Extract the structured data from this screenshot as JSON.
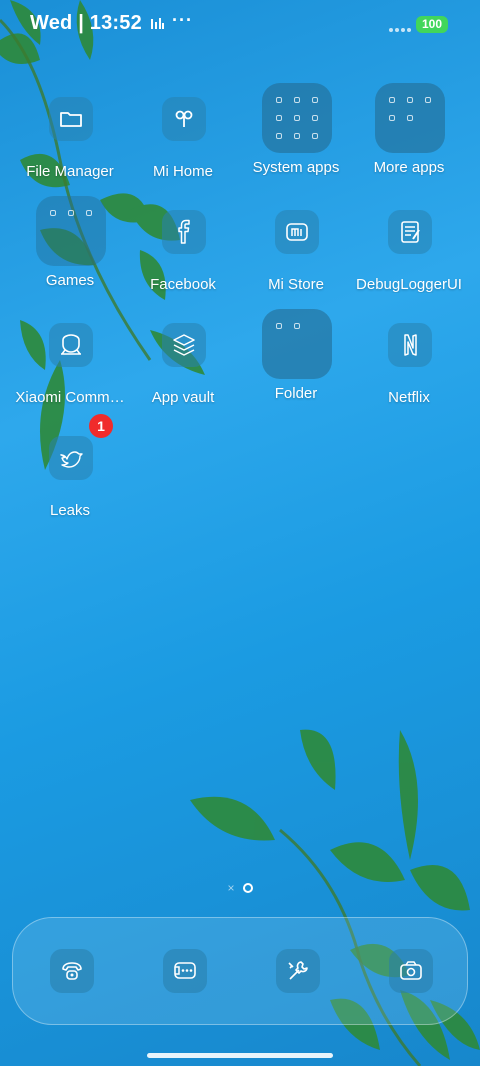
{
  "status_bar": {
    "time": "Wed | 13:52",
    "dots": "···",
    "battery": "100"
  },
  "apps": [
    {
      "label": "File Manager",
      "icon": "folder-icon"
    },
    {
      "label": "Mi Home",
      "icon": "mi-home-icon"
    },
    {
      "label": "System apps",
      "icon": "folder-grid"
    },
    {
      "label": "More apps",
      "icon": "folder-grid"
    },
    {
      "label": "Games",
      "icon": "folder-grid"
    },
    {
      "label": "Facebook",
      "icon": "facebook-icon"
    },
    {
      "label": "Mi Store",
      "icon": "mi-store-icon"
    },
    {
      "label": "DebugLoggerUI",
      "icon": "debug-logger-icon"
    },
    {
      "label": "Xiaomi Comm…",
      "icon": "xiaomi-community-icon"
    },
    {
      "label": "App vault",
      "icon": "app-vault-icon"
    },
    {
      "label": "Folder",
      "icon": "folder-grid"
    },
    {
      "label": "Netflix",
      "icon": "netflix-icon"
    },
    {
      "label": "Leaks",
      "icon": "bird-icon"
    }
  ],
  "leaks_badge": "1",
  "page_indicator": {
    "x_glyph": "×"
  },
  "dock": [
    {
      "icon": "phone-icon"
    },
    {
      "icon": "messages-icon"
    },
    {
      "icon": "tools-icon"
    },
    {
      "icon": "camera-icon"
    }
  ],
  "colors": {
    "accent": "#2ea8ec",
    "battery": "#41d65b",
    "badge": "#f02b2b"
  }
}
